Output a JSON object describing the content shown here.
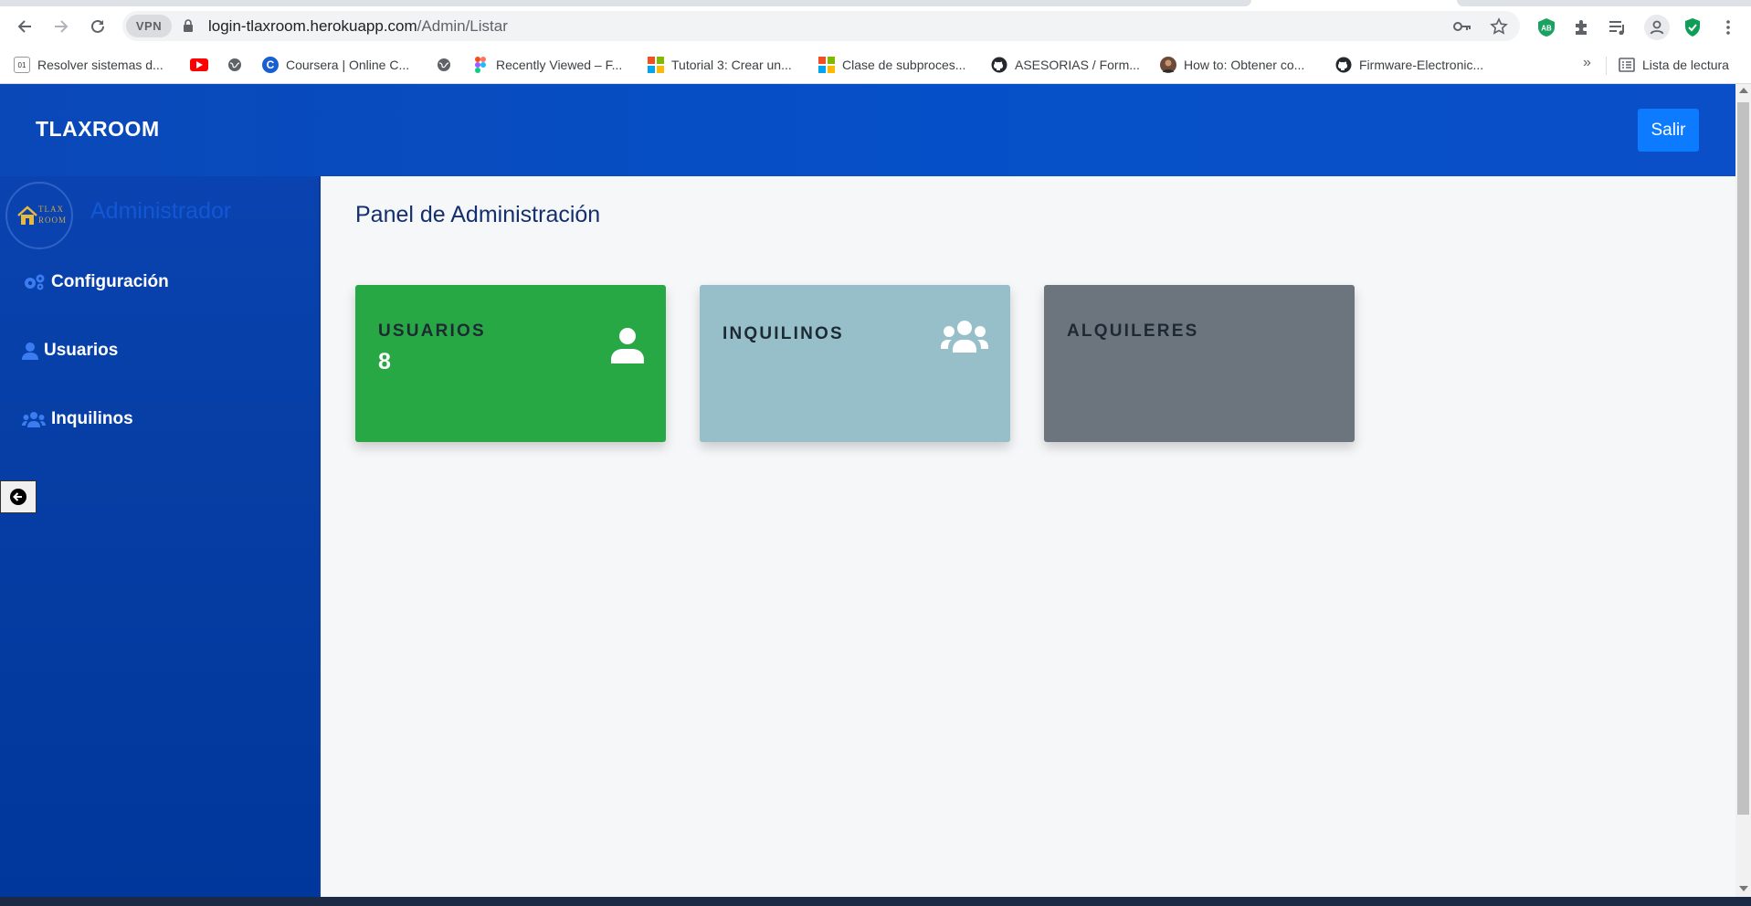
{
  "browser": {
    "vpn_label": "VPN",
    "url_host": "login-tlaxroom.herokuapp.com",
    "url_path": "/Admin/Listar",
    "bookmarks": [
      "Resolver sistemas d...",
      "",
      "",
      "Coursera | Online C...",
      "",
      "Recently Viewed – F...",
      "Tutorial 3: Crear un...",
      "Clase de subproces...",
      "ASESORIAS / Form...",
      "How to: Obtener co...",
      "Firmware-Electronic..."
    ],
    "more_label": "»",
    "reading_list": "Lista de lectura",
    "extension_badge": "AB"
  },
  "app": {
    "brand": "TLAXROOM",
    "logout_label": "Salir",
    "avatar_text_1": "TLAX",
    "avatar_text_2": "ROOM",
    "role": "Administrador",
    "menu": {
      "config": "Configuración",
      "users": "Usuarios",
      "tenants": "Inquilinos"
    },
    "page_title": "Panel de Administración",
    "cards": {
      "users_label": "USUARIOS",
      "users_count": "8",
      "tenants_label": "INQUILINOS",
      "rentals_label": "ALQUILERES"
    },
    "colors": {
      "nav_blue": "#0550c8",
      "sidebar_blue": "#063ea5",
      "card_green": "#28a745",
      "card_teal": "#96bfc9",
      "card_gray": "#6c747e",
      "salir_blue": "#0d7bff"
    }
  }
}
